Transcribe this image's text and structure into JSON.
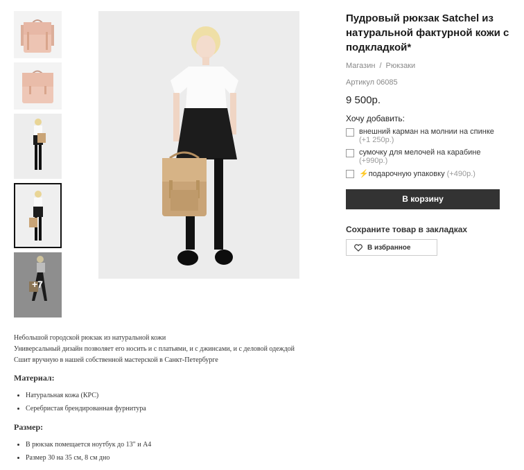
{
  "product": {
    "title": "Пудровый рюкзак Satchel из натуральной фактурной кожи с подкладкой*",
    "breadcrumb": [
      "Магазин",
      "Рюкзаки"
    ],
    "breadcrumb_separator": "/",
    "sku": "Артикул 06085",
    "price": "9 500р."
  },
  "gallery": {
    "more_label": "+7",
    "selected_index": 3
  },
  "addons": {
    "title": "Хочу добавить:",
    "items": [
      {
        "label": "внешний карман на молнии на спинке",
        "extra": "(+1 250р.)"
      },
      {
        "label": "сумочку для мелочей на карабине",
        "extra": "(+990р.)"
      },
      {
        "label": "⚡подарочную упаковку",
        "extra": "(+490р.)"
      }
    ]
  },
  "actions": {
    "cart_label": "В корзину",
    "bookmarks_title": "Сохраните товар в закладках",
    "favorite_label": "В избранное"
  },
  "description": {
    "lines": [
      "Небольшой городской рюкзак из натуральной кожи",
      "Универсальный дизайн позволяет его носить и с платьями, и с джинсами, и с деловой одеждой",
      "Сшит вручную в нашей собственной мастерской в Санкт-Петербурге"
    ],
    "material_title": "Материал:",
    "material_items": [
      "Натуральная кожа (КРС)",
      "Серебристая брендированная фурнитура"
    ],
    "size_title": "Размер:",
    "size_items": [
      "В рюкзак помещается ноутбук до 13\" и А4",
      "Размер 30 на 35 см, 8 см дно"
    ]
  },
  "colors": {
    "cart_button": "#333333",
    "bag_pink": "#edc4b3",
    "bag_tan": "#c9a477"
  }
}
